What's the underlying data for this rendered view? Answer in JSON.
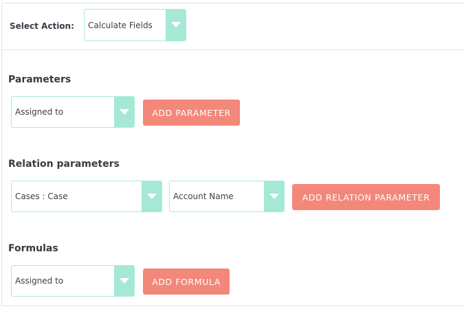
{
  "action": {
    "label": "Select Action:",
    "selected": "Calculate Fields"
  },
  "parameters": {
    "title": "Parameters",
    "select_value": "Assigned to",
    "add_button": "ADD PARAMETER"
  },
  "relation_parameters": {
    "title": "Relation parameters",
    "module_value": "Cases : Case",
    "field_value": "Account Name",
    "add_button": "ADD RELATION PARAMETER"
  },
  "formulas": {
    "title": "Formulas",
    "select_value": "Assigned to",
    "add_button": "ADD FORMULA"
  },
  "colors": {
    "dropdown_border": "#a6ebd9",
    "dropdown_arrow_bg": "#a5e8d6",
    "button_bg": "#f3877a",
    "button_text": "#ffffff"
  },
  "icons": {
    "dropdown": "chevron-down-icon"
  }
}
